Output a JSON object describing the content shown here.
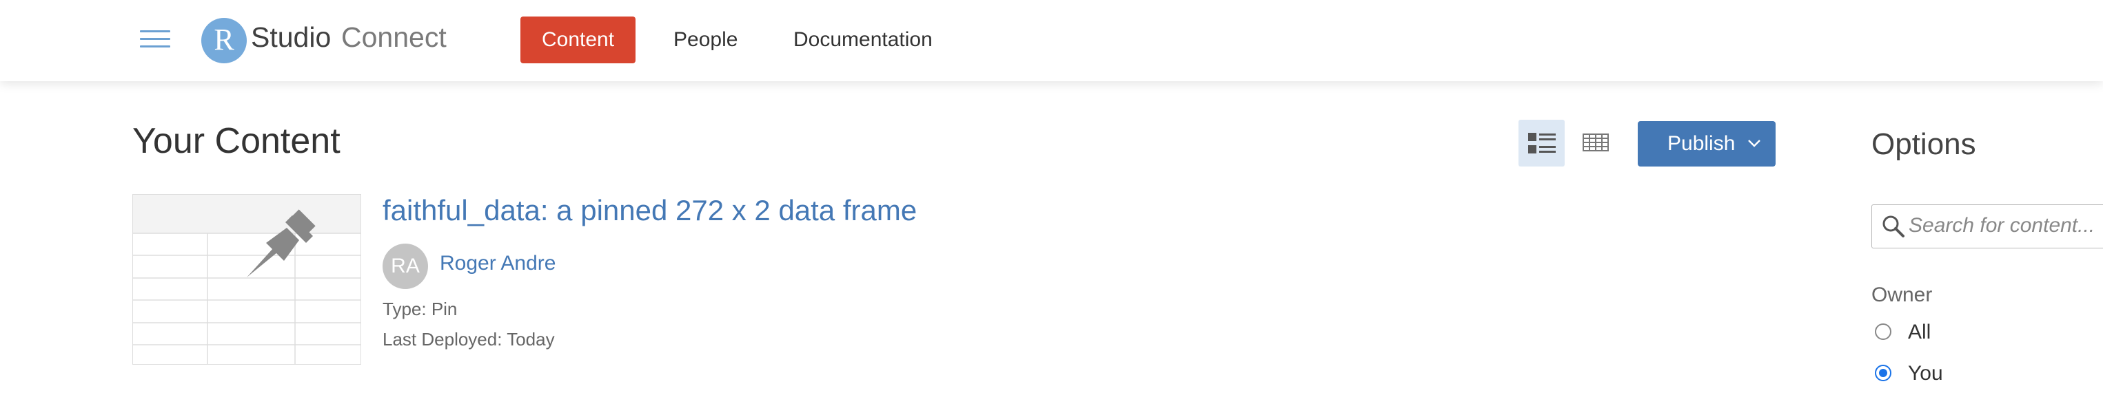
{
  "app": {
    "logo_letter": "R",
    "logo_word_1": "Studio",
    "logo_word_2": "Connect"
  },
  "nav": {
    "items": [
      {
        "label": "Content",
        "active": true
      },
      {
        "label": "People",
        "active": false
      },
      {
        "label": "Documentation",
        "active": false
      }
    ]
  },
  "main": {
    "title": "Your Content",
    "view_modes": [
      {
        "icon": "list-view-icon",
        "selected": true
      },
      {
        "icon": "grid-view-icon",
        "selected": false
      }
    ],
    "publish_label": "Publish",
    "content_items": [
      {
        "title": "faithful_data: a pinned 272 x 2 data frame",
        "owner_initials": "RA",
        "owner_name": "Roger Andre",
        "type_text": "Type: Pin",
        "deployed_text": "Last Deployed: Today",
        "thumbnail_icon": "pushpin-icon"
      }
    ]
  },
  "options": {
    "title": "Options",
    "search_placeholder": "Search for content...",
    "owner_label": "Owner",
    "owner_choices": [
      {
        "label": "All",
        "checked": false
      },
      {
        "label": "You",
        "checked": true
      }
    ]
  },
  "colors": {
    "accent_red": "#d8452f",
    "link_blue": "#4478b5",
    "logo_blue": "#75aadb",
    "selected_view_bg": "#dde8f4"
  }
}
